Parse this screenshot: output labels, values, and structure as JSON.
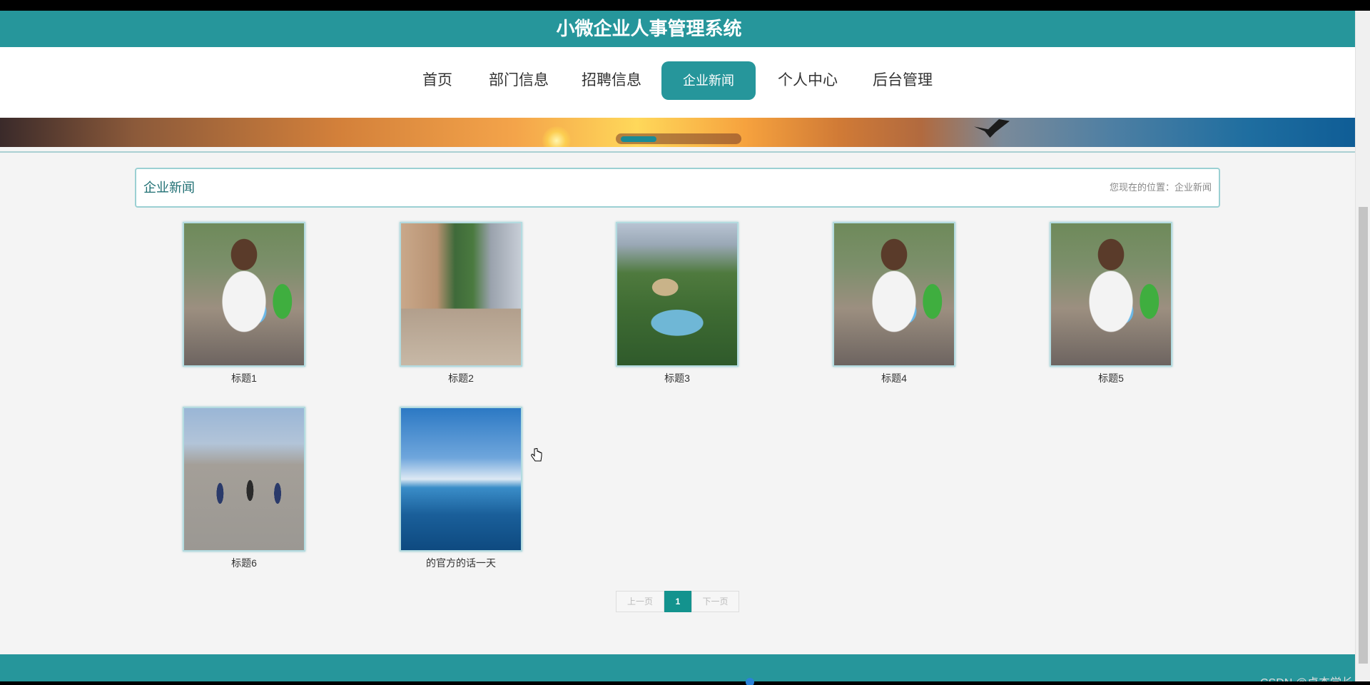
{
  "header": {
    "title": "小微企业人事管理系统"
  },
  "nav": {
    "items": [
      {
        "label": "首页"
      },
      {
        "label": "部门信息"
      },
      {
        "label": "招聘信息"
      },
      {
        "label": "企业新闻"
      },
      {
        "label": "个人中心"
      },
      {
        "label": "后台管理"
      }
    ],
    "active": "企业新闻"
  },
  "panel": {
    "title": "企业新闻",
    "breadcrumb": "您现在的位置：企业新闻"
  },
  "news": [
    {
      "caption": "标题1"
    },
    {
      "caption": "标题2"
    },
    {
      "caption": "标题3"
    },
    {
      "caption": "标题4"
    },
    {
      "caption": "标题5"
    },
    {
      "caption": "标题6"
    },
    {
      "caption": "的官方的话一天"
    }
  ],
  "pagination": {
    "prev": "上一页",
    "current": "1",
    "next": "下一页"
  },
  "watermark": "CSDN @卓杰学长",
  "colors": {
    "accent": "#26969b",
    "page_bg": "#f4f4f4"
  }
}
